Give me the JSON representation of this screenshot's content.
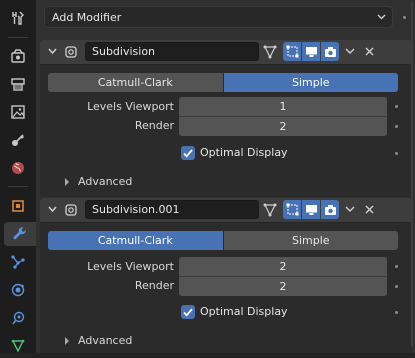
{
  "sidebar": {
    "tabs": [
      {
        "name": "tool-tab",
        "icon": "tool-icon"
      },
      {
        "name": "render-tab",
        "icon": "render-icon"
      },
      {
        "name": "output-tab",
        "icon": "output-icon"
      },
      {
        "name": "view-layer-tab",
        "icon": "view-layer-icon"
      },
      {
        "name": "scene-tab",
        "icon": "scene-icon"
      },
      {
        "name": "world-tab",
        "icon": "world-icon"
      },
      {
        "name": "object-tab",
        "icon": "object-icon"
      },
      {
        "name": "modifiers-tab",
        "icon": "wrench-icon",
        "active": true
      },
      {
        "name": "particles-tab",
        "icon": "particles-icon"
      },
      {
        "name": "physics-tab",
        "icon": "physics-icon"
      },
      {
        "name": "constraints-tab",
        "icon": "constraints-icon"
      },
      {
        "name": "data-tab",
        "icon": "mesh-data-icon"
      }
    ]
  },
  "add_modifier": {
    "label": "Add Modifier"
  },
  "modifiers": [
    {
      "name": "Subdivision",
      "mode_options": [
        "Catmull-Clark",
        "Simple"
      ],
      "selected_mode": "Simple",
      "levels_viewport_label": "Levels Viewport",
      "levels_viewport": "1",
      "render_label": "Render",
      "render": "2",
      "optimal_display_label": "Optimal Display",
      "optimal_display": true,
      "advanced_label": "Advanced"
    },
    {
      "name": "Subdivision.001",
      "mode_options": [
        "Catmull-Clark",
        "Simple"
      ],
      "selected_mode": "Catmull-Clark",
      "levels_viewport_label": "Levels Viewport",
      "levels_viewport": "2",
      "render_label": "Render",
      "render": "2",
      "optimal_display_label": "Optimal Display",
      "optimal_display": true,
      "advanced_label": "Advanced"
    }
  ],
  "colors": {
    "accent": "#4772b3",
    "panel_header": "#3d3d3d",
    "panel_body": "#2b2b2b",
    "field": "#545454",
    "background": "#303030"
  }
}
